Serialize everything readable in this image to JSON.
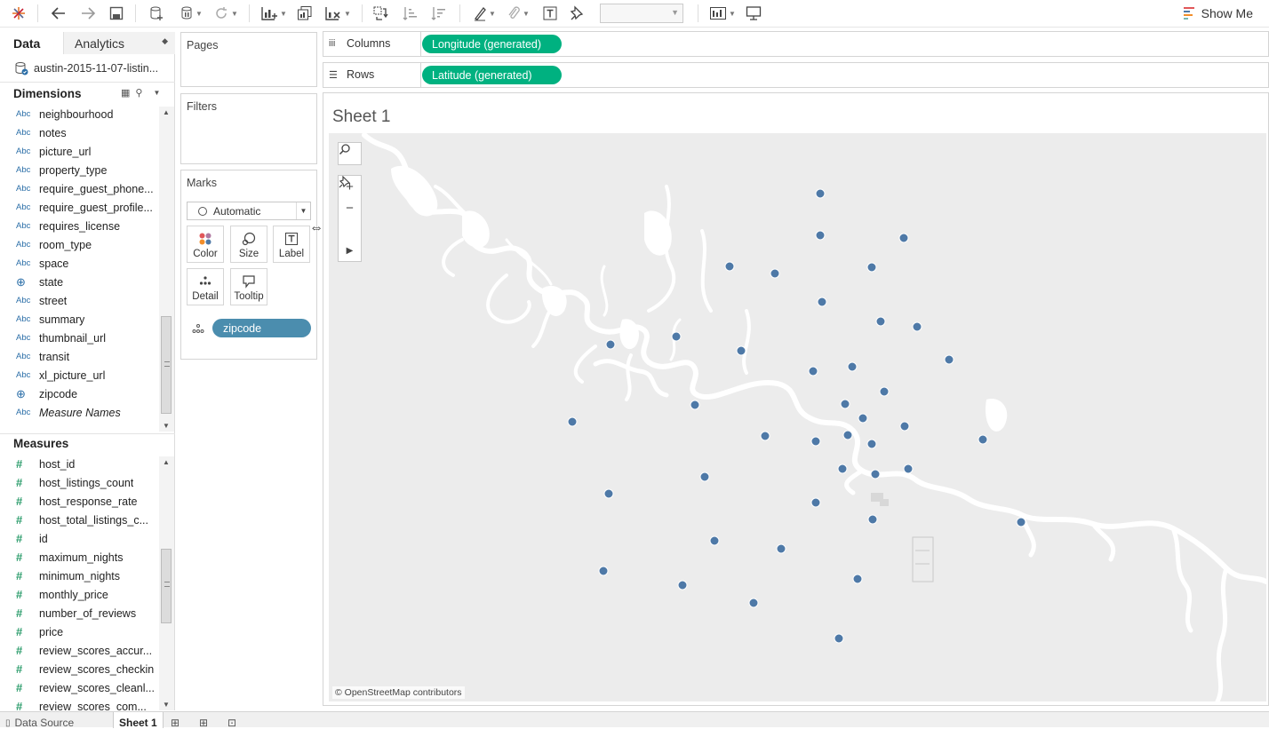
{
  "toolbar": {
    "fit_value": "",
    "show_me_label": "Show Me",
    "show_me_colors": [
      "#e15759",
      "#4e79a7",
      "#f28e2b",
      "#76b7b2"
    ]
  },
  "data_pane": {
    "tabs": {
      "data": "Data",
      "analytics": "Analytics"
    },
    "datasource": "austin-2015-11-07-listin...",
    "dimensions_header": "Dimensions",
    "dimensions": [
      {
        "type": "Abc",
        "name": "neighbourhood"
      },
      {
        "type": "Abc",
        "name": "notes"
      },
      {
        "type": "Abc",
        "name": "picture_url"
      },
      {
        "type": "Abc",
        "name": "property_type"
      },
      {
        "type": "Abc",
        "name": "require_guest_phone..."
      },
      {
        "type": "Abc",
        "name": "require_guest_profile..."
      },
      {
        "type": "Abc",
        "name": "requires_license"
      },
      {
        "type": "Abc",
        "name": "room_type"
      },
      {
        "type": "Abc",
        "name": "space"
      },
      {
        "type": "geo",
        "name": "state"
      },
      {
        "type": "Abc",
        "name": "street"
      },
      {
        "type": "Abc",
        "name": "summary"
      },
      {
        "type": "Abc",
        "name": "thumbnail_url"
      },
      {
        "type": "Abc",
        "name": "transit"
      },
      {
        "type": "Abc",
        "name": "xl_picture_url"
      },
      {
        "type": "geo",
        "name": "zipcode"
      },
      {
        "type": "Abc",
        "name": "Measure Names",
        "italic": true
      }
    ],
    "measures_header": "Measures",
    "measures": [
      {
        "name": "host_id"
      },
      {
        "name": "host_listings_count"
      },
      {
        "name": "host_response_rate"
      },
      {
        "name": "host_total_listings_c..."
      },
      {
        "name": "id"
      },
      {
        "name": "maximum_nights"
      },
      {
        "name": "minimum_nights"
      },
      {
        "name": "monthly_price"
      },
      {
        "name": "number_of_reviews"
      },
      {
        "name": "price"
      },
      {
        "name": "review_scores_accur..."
      },
      {
        "name": "review_scores_checkin"
      },
      {
        "name": "review_scores_cleanl..."
      },
      {
        "name": "review_scores_com..."
      }
    ]
  },
  "cards": {
    "pages": "Pages",
    "filters": "Filters",
    "marks": "Marks",
    "mark_type": "Automatic",
    "mark_buttons": {
      "color": "Color",
      "size": "Size",
      "label": "Label",
      "detail": "Detail",
      "tooltip": "Tooltip"
    },
    "detail_pill": "zipcode"
  },
  "shelves": {
    "columns_label": "Columns",
    "columns_pill": "Longitude (generated)",
    "rows_label": "Rows",
    "rows_pill": "Latitude (generated)"
  },
  "viz": {
    "sheet_title": "Sheet 1",
    "attribution": "© OpenStreetMap contributors",
    "mark_color": "#4e79a7"
  },
  "bottom_tabs": {
    "data_source": "Data Source",
    "sheet": "Sheet 1"
  }
}
